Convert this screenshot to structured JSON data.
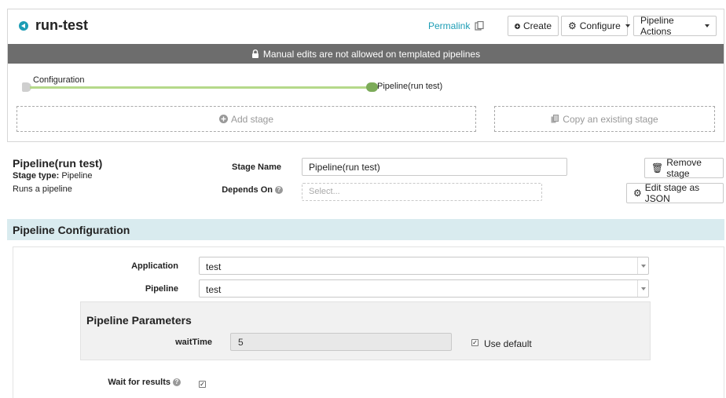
{
  "header": {
    "title": "run-test",
    "permalink": "Permalink",
    "create_label": "Create",
    "configure_label": "Configure",
    "pipeline_actions_label": "Pipeline Actions"
  },
  "banner": {
    "text": "Manual edits are not allowed on templated pipelines"
  },
  "graph": {
    "start_label": "Configuration",
    "end_label": "Pipeline(run test)",
    "add_stage_label": "Add stage",
    "copy_stage_label": "Copy an existing stage"
  },
  "stage": {
    "title": "Pipeline(run test)",
    "type_key": "Stage type:",
    "type_value": "Pipeline",
    "description": "Runs a pipeline",
    "name_label": "Stage Name",
    "name_value": "Pipeline(run test)",
    "depends_label": "Depends On",
    "depends_placeholder": "Select...",
    "remove_label": "Remove stage",
    "edit_json_label": "Edit stage as JSON"
  },
  "config": {
    "section_title": "Pipeline Configuration",
    "application_label": "Application",
    "application_value": "test",
    "pipeline_label": "Pipeline",
    "pipeline_value": "test",
    "params_title": "Pipeline Parameters",
    "param_name": "waitTime",
    "param_value": "5",
    "use_default_label": "Use default",
    "use_default_checked": true,
    "wait_label": "Wait for results",
    "wait_checked": true
  },
  "colors": {
    "accent": "#1d9db5",
    "banner_bg": "#6d6d6d",
    "section_bg": "#d9ebef",
    "graph_line": "#b5d98a",
    "graph_node": "#7cab59"
  }
}
